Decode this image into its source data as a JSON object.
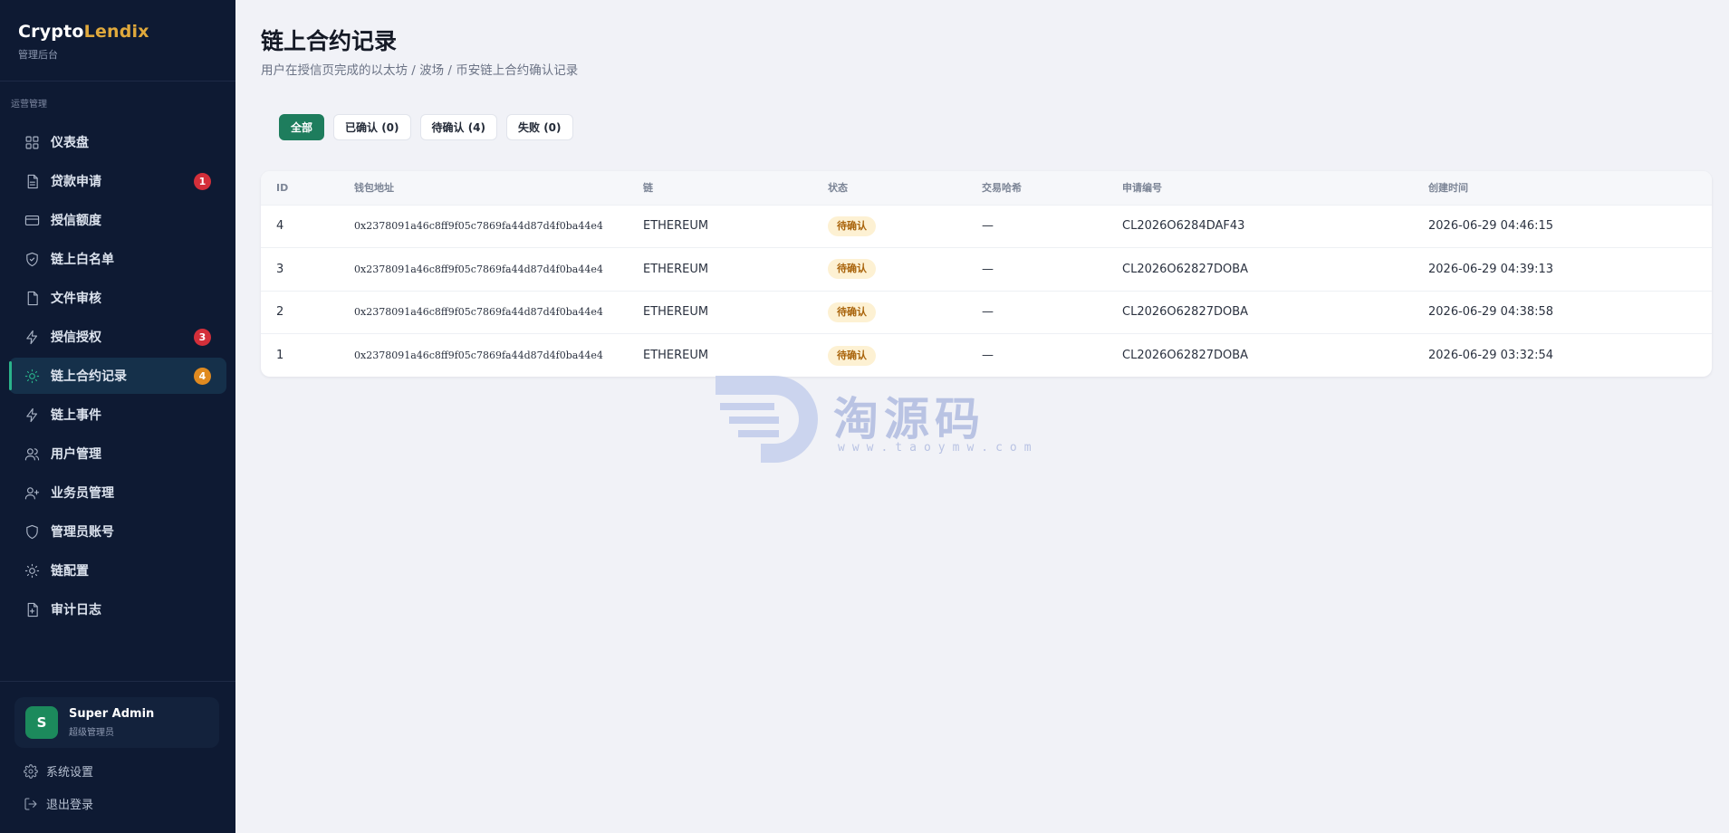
{
  "sidebar": {
    "brand_part1": "Crypto",
    "brand_part2": "Lendix",
    "brand_sub": "管理后台",
    "section_title": "运营管理",
    "items": [
      {
        "label": "仪表盘",
        "icon": "grid-icon",
        "badge": null
      },
      {
        "label": "贷款申请",
        "icon": "document-icon",
        "badge": "1"
      },
      {
        "label": "授信额度",
        "icon": "card-icon",
        "badge": null
      },
      {
        "label": "链上白名单",
        "icon": "shield-check-icon",
        "badge": null
      },
      {
        "label": "文件审核",
        "icon": "file-icon",
        "badge": null
      },
      {
        "label": "授信授权",
        "icon": "lightning-icon",
        "badge": "3"
      },
      {
        "label": "链上合约记录",
        "icon": "sun-icon",
        "badge": "4",
        "active": true
      },
      {
        "label": "链上事件",
        "icon": "lightning-icon",
        "badge": null
      },
      {
        "label": "用户管理",
        "icon": "users-icon",
        "badge": null
      },
      {
        "label": "业务员管理",
        "icon": "user-plus-icon",
        "badge": null
      },
      {
        "label": "管理员账号",
        "icon": "shield-icon",
        "badge": null
      },
      {
        "label": "链配置",
        "icon": "sun-icon",
        "badge": null
      },
      {
        "label": "审计日志",
        "icon": "file-plus-icon",
        "badge": null
      }
    ],
    "user": {
      "avatar": "S",
      "name": "Super Admin",
      "role": "超级管理员"
    },
    "settings_label": "系统设置",
    "logout_label": "退出登录"
  },
  "main": {
    "title": "链上合约记录",
    "subtitle": "用户在授信页完成的以太坊 / 波场 / 币安链上合约确认记录",
    "tabs": [
      {
        "label": "全部",
        "active": true
      },
      {
        "label": "已确认 (0)"
      },
      {
        "label": "待确认 (4)"
      },
      {
        "label": "失败 (0)"
      }
    ],
    "table": {
      "columns": [
        "ID",
        "钱包地址",
        "链",
        "状态",
        "交易哈希",
        "申请编号",
        "创建时间"
      ],
      "rows": [
        [
          "4",
          "0x2378091a46c8ff9f05c7869fa44d87d4f0ba44e4",
          "ETHEREUM",
          "待确认",
          "—",
          "CL2026O6284DAF43",
          "2026-06-29 04:46:15"
        ],
        [
          "3",
          "0x2378091a46c8ff9f05c7869fa44d87d4f0ba44e4",
          "ETHEREUM",
          "待确认",
          "—",
          "CL2026O62827DOBA",
          "2026-06-29 04:39:13"
        ],
        [
          "2",
          "0x2378091a46c8ff9f05c7869fa44d87d4f0ba44e4",
          "ETHEREUM",
          "待确认",
          "—",
          "CL2026O62827DOBA",
          "2026-06-29 04:38:58"
        ],
        [
          "1",
          "0x2378091a46c8ff9f05c7869fa44d87d4f0ba44e4",
          "ETHEREUM",
          "待确认",
          "—",
          "CL2026O62827DOBA",
          "2026-06-29 03:32:54"
        ]
      ]
    }
  },
  "watermark": {
    "text": "淘源码",
    "url": "www.taoymw.com"
  }
}
